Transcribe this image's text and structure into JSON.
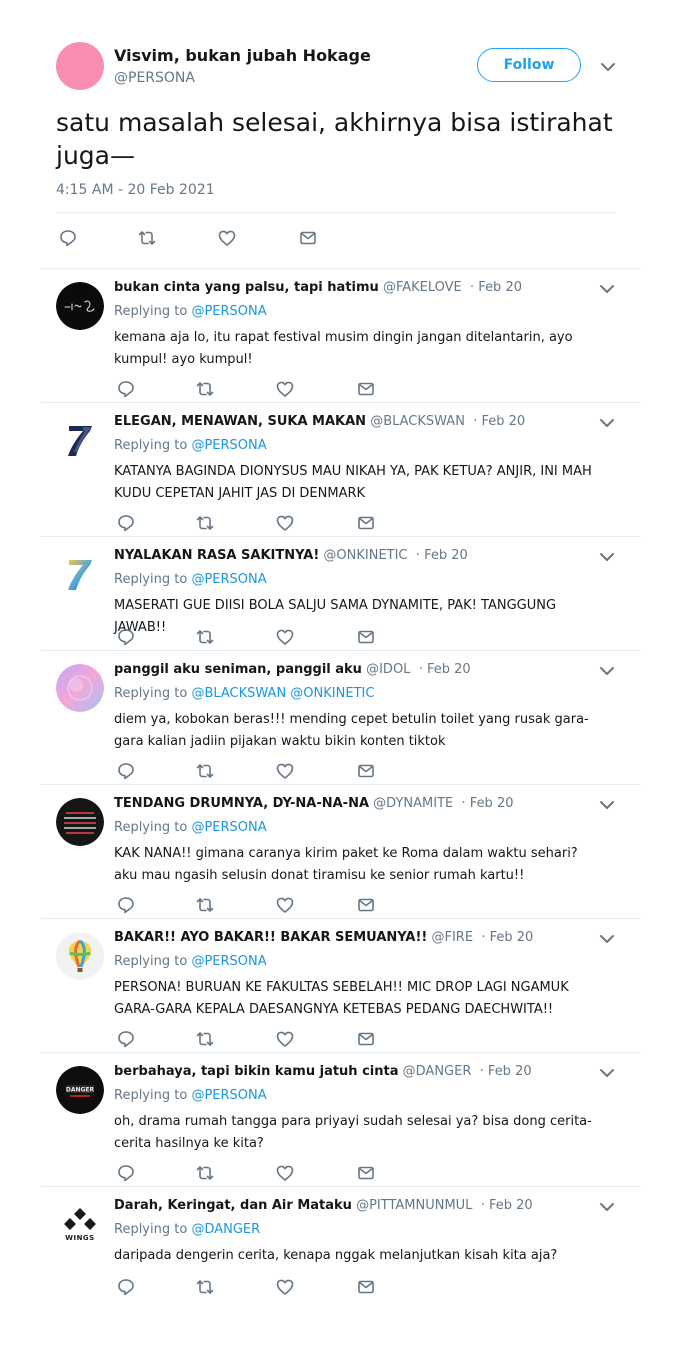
{
  "main_tweet": {
    "name": "Visvim, bukan jubah Hokage",
    "handle": "@PERSONA",
    "follow_label": "Follow",
    "text": "satu masalah selesai, akhirnya bisa istirahat juga—",
    "timestamp": "4:15 AM - 20 Feb 2021",
    "avatar_color": "#f88fb0"
  },
  "colors": {
    "accent": "#1da1f2",
    "link": "#1b95e0",
    "muted": "#657786",
    "divider": "#e6ecf0"
  },
  "replying_label": "Replying to",
  "replies": [
    {
      "name": "bukan cinta yang palsu, tapi hatimu",
      "handle": "@FAKELOVE",
      "date": "Feb 20",
      "replying_to": "@PERSONA",
      "text": "kemana aja lo, itu rapat festival musim dingin jangan ditelantarin, ayo kumpul! ayo kumpul!",
      "avatar": "dark-signature-avatar"
    },
    {
      "name": "ELEGAN, MENAWAN, SUKA MAKAN",
      "handle": "@BLACKSWAN",
      "date": "Feb 20",
      "replying_to": "@PERSONA",
      "text": "KATANYA BAGINDA DIONYSUS MAU NIKAH YA, PAK KETUA? ANJIR, INI MAH KUDU CEPETAN JAHIT JAS DI DENMARK",
      "avatar": "navy-seven-avatar",
      "avatar_glyph": "7"
    },
    {
      "name": "NYALAKAN RASA SAKITNYA!",
      "handle": "@ONKINETIC",
      "date": "Feb 20",
      "replying_to": "@PERSONA",
      "text": "MASERATI GUE DIISI BOLA SALJU SAMA DYNAMITE, PAK! TANGGUNG JAWAB!!",
      "avatar": "gold-blue-seven-avatar",
      "avatar_glyph": "7"
    },
    {
      "name": "panggil aku seniman, panggil aku",
      "handle": "@IDOL",
      "date": "Feb 20",
      "replying_to": "@BLACKSWAN @ONKINETIC",
      "text": "diem ya, kobokan beras!!! mending cepet betulin toilet yang rusak gara-gara kalian jadiin pijakan waktu bikin konten tiktok",
      "avatar": "pastel-gradient-avatar"
    },
    {
      "name": "TENDANG DRUMNYA, DY-NA-NA-NA",
      "handle": "@DYNAMITE",
      "date": "Feb 20",
      "replying_to": "@PERSONA",
      "text": "KAK NANA!! gimana caranya kirim paket ke Roma dalam waktu sehari? aku mau ngasih selusin donat tiramisu ke senior rumah kartu!!",
      "avatar": "dark-neon-text-avatar"
    },
    {
      "name": "BAKAR!! AYO BAKAR!! BAKAR SEMUANYA!!",
      "handle": "@FIRE",
      "date": "Feb 20",
      "replying_to": "@PERSONA",
      "text": "PERSONA! BURUAN KE FAKULTAS SEBELAH!! MIC DROP LAGI NGAMUK GARA-GARA KEPALA DAESANGNYA KETEBAS PEDANG DAECHWITA!!",
      "avatar": "hot-air-balloon-avatar"
    },
    {
      "name": "berbahaya, tapi bikin kamu jatuh cinta",
      "handle": "@DANGER",
      "date": "Feb 20",
      "replying_to": "@PERSONA",
      "text": "oh, drama rumah tangga para priyayi sudah selesai ya? bisa dong cerita-cerita hasilnya ke kita?",
      "avatar": "dark-logo-avatar",
      "avatar_text": "DANGER"
    },
    {
      "name": "Darah, Keringat, dan Air Mataku",
      "handle": "@PITTAMNUNMUL",
      "date": "Feb 20",
      "replying_to": "@DANGER",
      "text": "daripada dengerin cerita, kenapa nggak melanjutkan kisah kita aja?",
      "avatar": "wings-logo-avatar",
      "avatar_text": "WINGS"
    }
  ]
}
